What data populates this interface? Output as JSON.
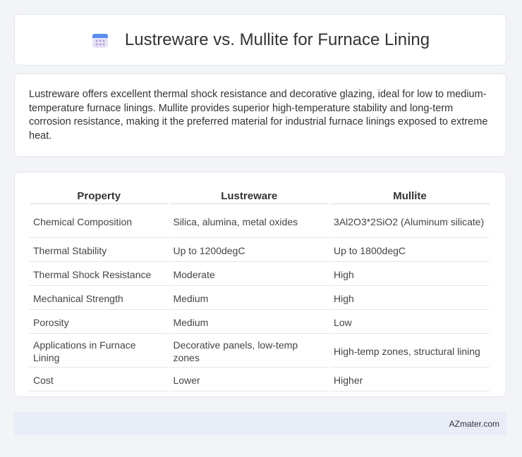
{
  "header": {
    "icon": "calendar-icon",
    "title": "Lustreware vs. Mullite for Furnace Lining"
  },
  "description": "Lustreware offers excellent thermal shock resistance and decorative glazing, ideal for low to medium-temperature furnace linings. Mullite provides superior high-temperature stability and long-term corrosion resistance, making it the preferred material for industrial furnace linings exposed to extreme heat.",
  "table": {
    "headers": [
      "Property",
      "Lustreware",
      "Mullite"
    ],
    "rows": [
      [
        "Chemical Composition",
        "Silica, alumina, metal oxides",
        "3Al2O3*2SiO2 (Aluminum silicate)"
      ],
      [
        "Thermal Stability",
        "Up to 1200degC",
        "Up to 1800degC"
      ],
      [
        "Thermal Shock Resistance",
        "Moderate",
        "High"
      ],
      [
        "Mechanical Strength",
        "Medium",
        "High"
      ],
      [
        "Porosity",
        "Medium",
        "Low"
      ],
      [
        "Applications in Furnace Lining",
        "Decorative panels, low-temp zones",
        "High-temp zones, structural lining"
      ],
      [
        "Cost",
        "Lower",
        "Higher"
      ]
    ]
  },
  "footer": {
    "brand": "AZmater.com"
  },
  "colors": {
    "background": "#f3f4f8",
    "card": "#ffffff",
    "footer": "#e8edf7"
  }
}
